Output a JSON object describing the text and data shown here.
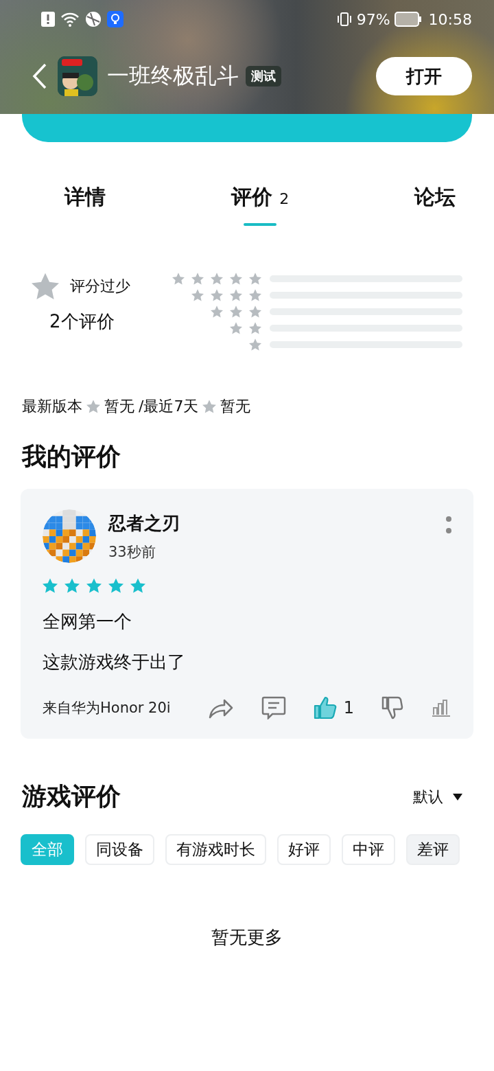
{
  "status_bar": {
    "battery": "97%",
    "time": "10:58"
  },
  "header": {
    "title": "一班终极乱斗",
    "tag": "测试",
    "button": "打开"
  },
  "tabs": [
    {
      "label": "详情",
      "selected": false
    },
    {
      "label": "评价",
      "count": "2",
      "selected": true
    },
    {
      "label": "论坛",
      "selected": false
    }
  ],
  "summary": {
    "score_text": "评分过少",
    "count": "2个评价",
    "distribution": [
      {
        "level": 0
      },
      {
        "level": 0
      },
      {
        "level": 0
      },
      {
        "level": 0
      },
      {
        "level": 0
      }
    ]
  },
  "version_line": {
    "latest_label": "最新版本",
    "latest_value": "暂无",
    "recent_label": "/最近7天",
    "recent_value": "暂无"
  },
  "my_review": {
    "heading": "我的评价",
    "user": "忍者之刃",
    "time": "33秒前",
    "stars": 5,
    "paragraphs": [
      "全网第一个",
      "这款游戏终于出了"
    ],
    "device": "来自华为Honor 20i",
    "likes": "1",
    "liked": true
  },
  "game_reviews": {
    "heading": "游戏评价",
    "sort": "默认",
    "filters": [
      {
        "label": "全部",
        "selected": true,
        "highlighted": false
      },
      {
        "label": "同设备",
        "selected": false,
        "highlighted": false
      },
      {
        "label": "有游戏时长",
        "selected": false,
        "highlighted": false
      },
      {
        "label": "好评",
        "selected": false,
        "highlighted": false
      },
      {
        "label": "中评",
        "selected": false,
        "highlighted": false
      },
      {
        "label": "差评",
        "selected": false,
        "highlighted": true
      }
    ],
    "empty_text": "暂无更多"
  }
}
